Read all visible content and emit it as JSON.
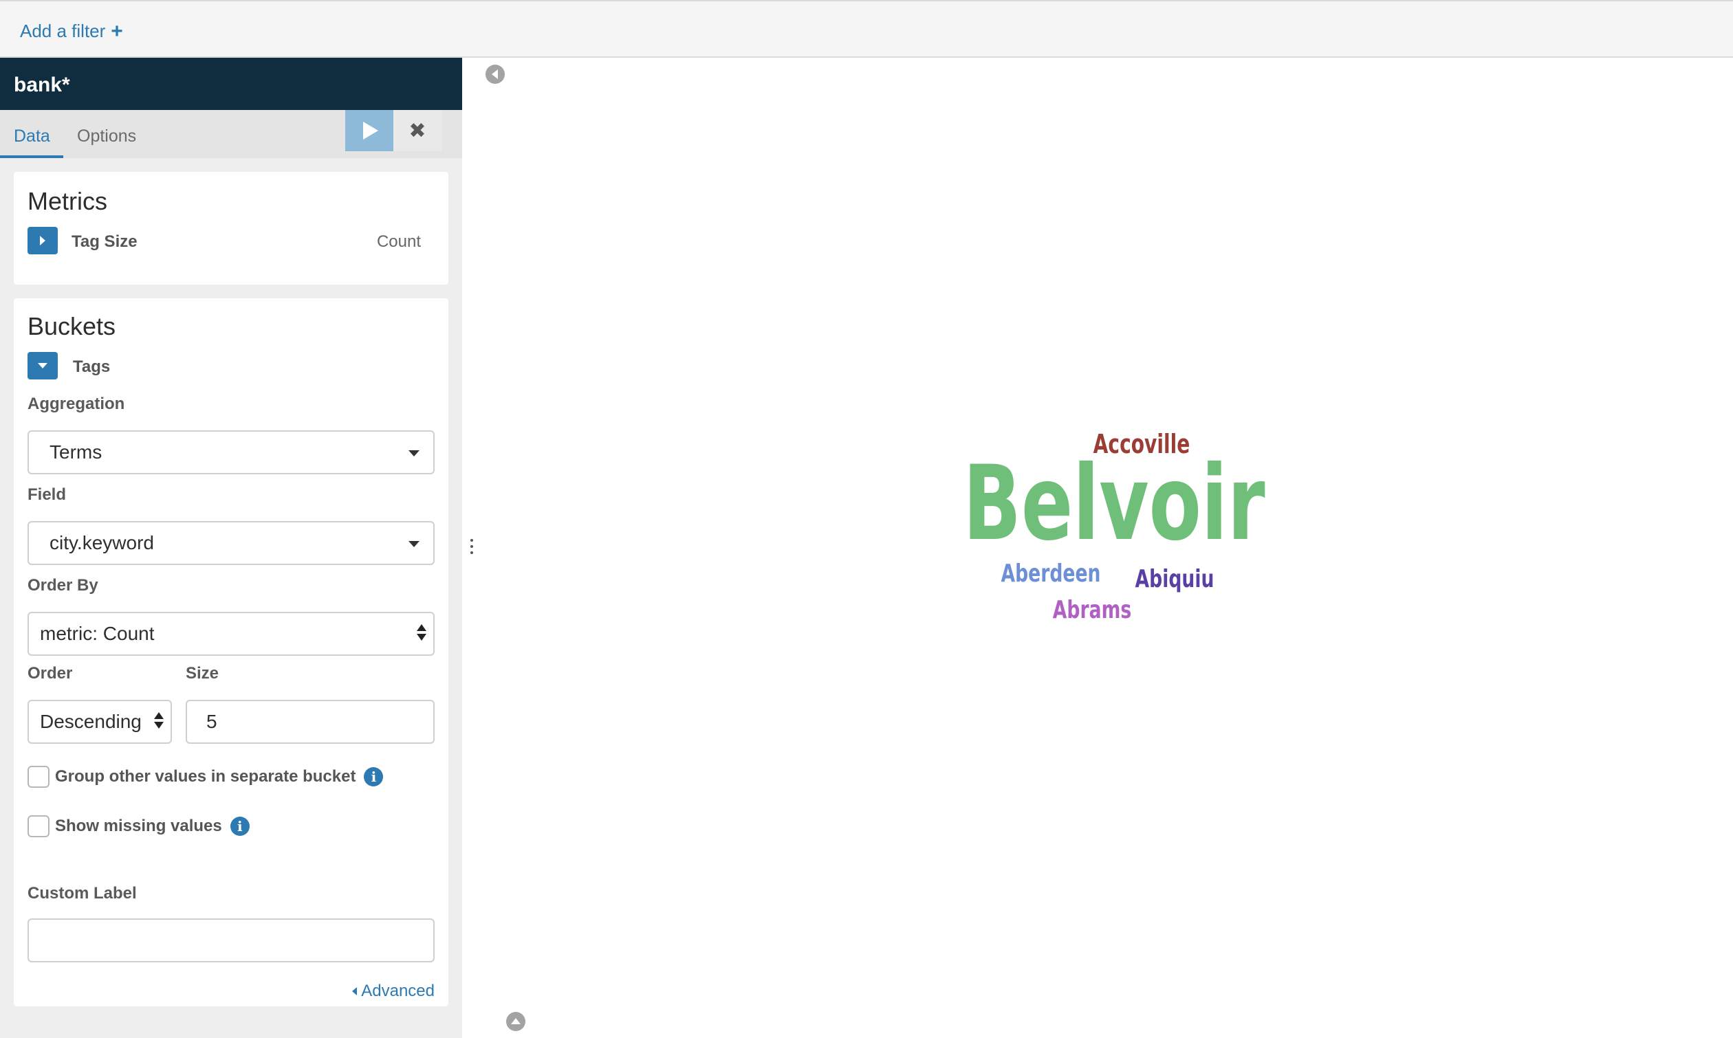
{
  "filter_bar": {
    "add_filter_label": "Add a filter",
    "plus_glyph": "+"
  },
  "sidebar": {
    "index_pattern": "bank*",
    "tabs": {
      "data": "Data",
      "options": "Options"
    },
    "discard_glyph": "✖",
    "metrics": {
      "title": "Metrics",
      "agg_name": "Tag Size",
      "agg_type": "Count"
    },
    "buckets": {
      "title": "Buckets",
      "agg_name": "Tags",
      "aggregation_label": "Aggregation",
      "aggregation_value": "Terms",
      "field_label": "Field",
      "field_value": "city.keyword",
      "order_by_label": "Order By",
      "order_by_value": "metric: Count",
      "order_label": "Order",
      "order_value": "Descending",
      "size_label": "Size",
      "size_value": "5",
      "group_other_label": "Group other values in separate bucket",
      "show_missing_label": "Show missing values",
      "custom_label_label": "Custom Label",
      "custom_label_value": "",
      "advanced_label": "Advanced"
    },
    "info_glyph": "i"
  },
  "chart_data": {
    "type": "wordcloud",
    "tags": [
      {
        "text": "Belvoir",
        "color": "#6fbf7a"
      },
      {
        "text": "Accoville",
        "color": "#9b3d35"
      },
      {
        "text": "Aberdeen",
        "color": "#6c8fd6"
      },
      {
        "text": "Abiquiu",
        "color": "#5a3fa5"
      },
      {
        "text": "Abrams",
        "color": "#b05fc2"
      }
    ]
  }
}
